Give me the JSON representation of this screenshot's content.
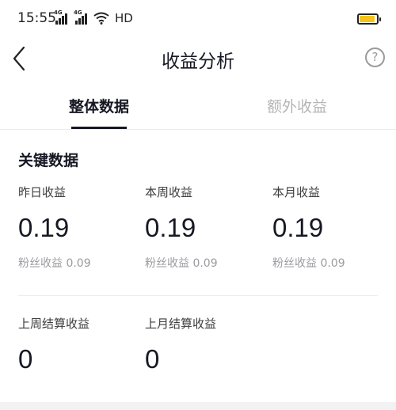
{
  "status_bar": {
    "time": "15:55",
    "signal1_label": "4G",
    "signal2_label": "4G",
    "network_label": "HD",
    "battery_color": "#f4c518"
  },
  "nav": {
    "title": "收益分析",
    "back_icon": "chevron-left-icon",
    "help_icon": "question-circle-icon",
    "help_glyph": "?"
  },
  "tabs": [
    {
      "label": "整体数据",
      "active": true
    },
    {
      "label": "额外收益",
      "active": false
    }
  ],
  "section": {
    "title": "关键数据"
  },
  "metrics": [
    {
      "label": "昨日收益",
      "value": "0.19",
      "sub": "粉丝收益 0.09"
    },
    {
      "label": "本周收益",
      "value": "0.19",
      "sub": "粉丝收益 0.09"
    },
    {
      "label": "本月收益",
      "value": "0.19",
      "sub": "粉丝收益 0.09"
    },
    {
      "label": "上周结算收益",
      "value": "0"
    },
    {
      "label": "上月结算收益",
      "value": "0"
    }
  ]
}
